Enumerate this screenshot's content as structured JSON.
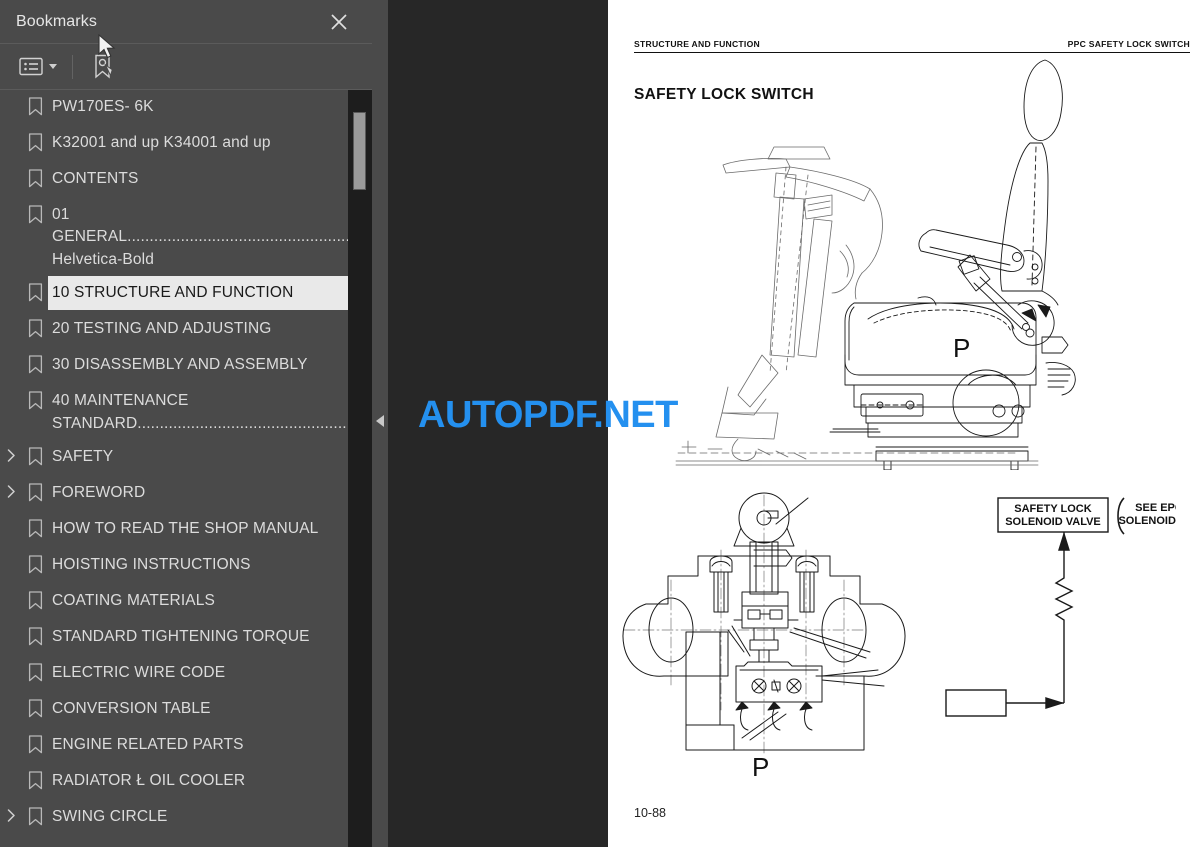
{
  "panel": {
    "title": "Bookmarks",
    "close_icon": "close-icon",
    "toolbar": {
      "options_icon": "list-options-icon",
      "caret_icon": "chevron-down-icon",
      "new_bookmark_icon": "new-bookmark-icon"
    },
    "collapse_icon": "collapse-left-arrow-icon"
  },
  "bookmarks": [
    {
      "label": "PW170ES- 6K",
      "expandable": false,
      "selected": false
    },
    {
      "label": "K32001 and up K34001 and up",
      "expandable": false,
      "selected": false
    },
    {
      "label": "CONTENTS",
      "expandable": false,
      "selected": false
    },
    {
      "label": "01\nGENERAL.............................................................\nHelvetica-Bold",
      "expandable": false,
      "selected": false
    },
    {
      "label": "10 STRUCTURE AND FUNCTION",
      "expandable": false,
      "selected": true
    },
    {
      "label": "20 TESTING AND ADJUSTING",
      "expandable": false,
      "selected": false
    },
    {
      "label": "30 DISASSEMBLY AND ASSEMBLY",
      "expandable": false,
      "selected": false
    },
    {
      "label": "40 MAINTENANCE\nSTANDARD..........................................................",
      "expandable": false,
      "selected": false
    },
    {
      "label": "SAFETY",
      "expandable": true,
      "selected": false
    },
    {
      "label": "FOREWORD",
      "expandable": true,
      "selected": false
    },
    {
      "label": "HOW TO READ THE SHOP MANUAL",
      "expandable": false,
      "selected": false
    },
    {
      "label": "HOISTING INSTRUCTIONS",
      "expandable": false,
      "selected": false
    },
    {
      "label": "COATING MATERIALS",
      "expandable": false,
      "selected": false
    },
    {
      "label": "STANDARD TIGHTENING TORQUE",
      "expandable": false,
      "selected": false
    },
    {
      "label": "ELECTRIC WIRE CODE",
      "expandable": false,
      "selected": false
    },
    {
      "label": "CONVERSION TABLE",
      "expandable": false,
      "selected": false
    },
    {
      "label": "ENGINE RELATED PARTS",
      "expandable": false,
      "selected": false
    },
    {
      "label": "RADIATOR Ł OIL COOLER",
      "expandable": false,
      "selected": false
    },
    {
      "label": "SWING CIRCLE",
      "expandable": true,
      "selected": false
    }
  ],
  "document": {
    "header_left": "STRUCTURE AND FUNCTION",
    "header_right": "PPC SAFETY LOCK SWITCH",
    "title": "SAFETY LOCK SWITCH",
    "page_number": "10-88",
    "figures": {
      "seat": {
        "name": "operator-seat-assembly-drawing",
        "port_label": "P"
      },
      "valve": {
        "name": "ppc-valve-section-drawing",
        "port_label": "P",
        "box_line1": "SAFETY LOCK",
        "box_line2": "SOLENOID VALVE",
        "note_line1": "SEE EPC",
        "note_line2": "SOLENOID VLV"
      }
    }
  },
  "watermark": {
    "text": "AUTOPDF.NET",
    "color": "#2490ef"
  },
  "theme": {
    "panel_bg": "#4a4a4a",
    "viewer_bg": "#272727",
    "page_bg": "#ffffff",
    "selection_bg": "#e9e9e9",
    "text": "#dcdcdc"
  }
}
